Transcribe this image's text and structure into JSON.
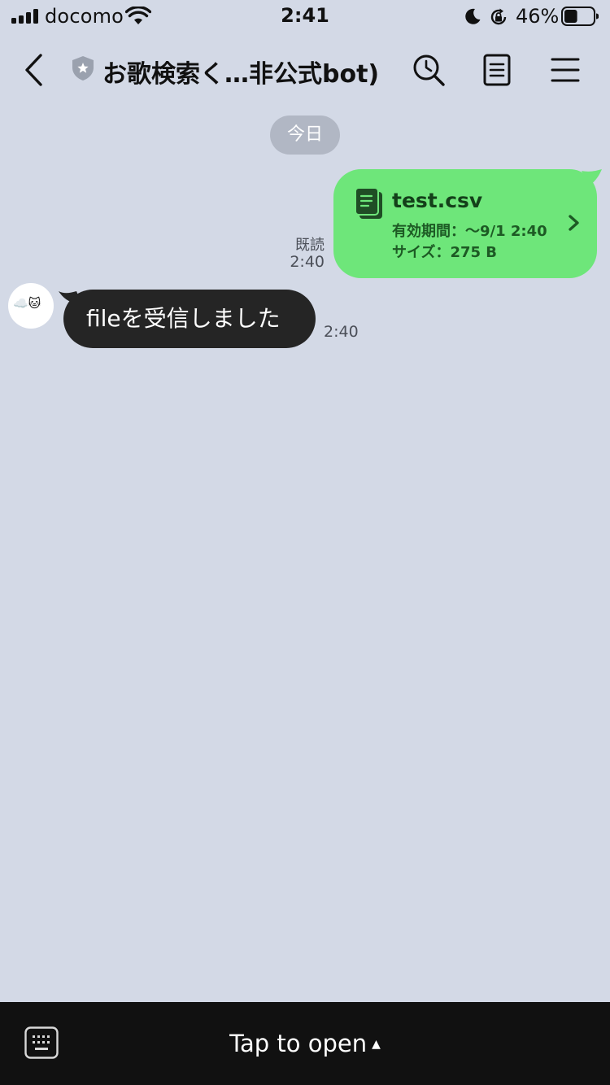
{
  "status_bar": {
    "carrier": "docomo",
    "time": "2:41",
    "battery_percent": "46%",
    "battery_level": 0.46,
    "icons": [
      "signal-icon",
      "wifi-icon",
      "moon-icon",
      "rotation-lock-icon",
      "battery-icon"
    ]
  },
  "header": {
    "title": "お歌検索く…非公式bot)",
    "icons": [
      "back-chevron-icon",
      "shield-star-icon",
      "search-clock-icon",
      "notes-icon",
      "menu-icon"
    ]
  },
  "chat": {
    "date_chip": "今日",
    "messages": [
      {
        "direction": "sent",
        "type": "file",
        "file_name": "test.csv",
        "expiry": "有効期間：～9/1 2:40",
        "size": "サイズ：275 B",
        "read_label": "既読",
        "time": "2:40"
      },
      {
        "direction": "received",
        "type": "text",
        "avatar_text": "☁️🐱",
        "text": "fileを受信しました",
        "time": "2:40"
      }
    ]
  },
  "bottom_bar": {
    "label": "Tap to open",
    "caret": "▲",
    "icon": "keyboard-icon"
  },
  "colors": {
    "background": "#d3d9e6",
    "sent_bubble": "#6ee67a",
    "received_bubble": "#252525",
    "date_chip": "#b1b7c4",
    "bottom_bar": "#111111"
  }
}
